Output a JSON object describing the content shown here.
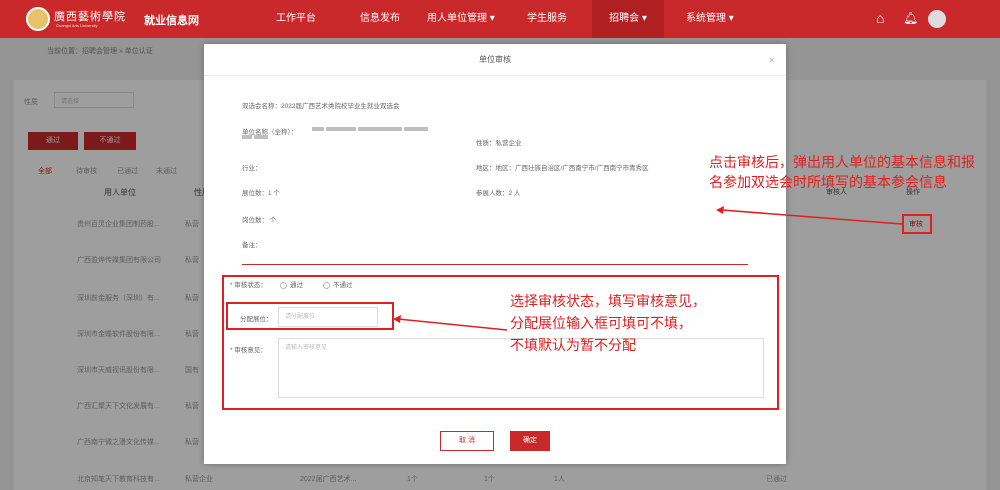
{
  "header": {
    "school": "廣西藝術學院",
    "school_en": "Guangxi Arts University",
    "site": "就业信息网",
    "nav": [
      "工作平台",
      "信息发布",
      "用人单位管理 ▾",
      "学生服务",
      "招聘会 ▾",
      "系统管理 ▾"
    ]
  },
  "breadcrumb": "当前位置：招聘会管理 » 单位认证",
  "background": {
    "filter_label": "性质",
    "filter_placeholder": "请选择",
    "pass": "通过",
    "fail": "不通过",
    "tabs": [
      "全部",
      "待审核",
      "已通过",
      "未通过"
    ],
    "col_company": "用人单位",
    "col_nature": "性质",
    "col_reviewer": "审核人",
    "col_op": "操作",
    "review_link": "审核",
    "rows": [
      "贵州百灵企业集团制药股...",
      "广西盈烨传媒集团有限公司",
      "深圳前金服务（深圳）有...",
      "深圳市金蝶软件股份有限...",
      "深圳市天威视讯股份有限...",
      "广西汇聚天下文化发展有...",
      "广西南宁微之漫文化传媒...",
      "北京知笔天下教育科技有..."
    ],
    "natures": [
      "私营",
      "私营",
      "私营",
      "私营",
      "国有",
      "私营",
      "私营",
      "私营企业"
    ],
    "last_row": {
      "fair": "2022届广西艺术...",
      "c1": "1个",
      "c2": "1个",
      "c3": "1人",
      "status": "已通过"
    }
  },
  "modal": {
    "title": "单位审核",
    "close": "×",
    "fair": "双选会名称：2022届广西艺术类院校毕业生就业双选会",
    "company": "单位名称（全称）：",
    "nature": "性质：私营企业",
    "industry": "行业：",
    "region": "地区：地区：广西壮族自治区/广西南宁市/广西南宁市青秀区",
    "booths": "展位数：1 个",
    "attendees": "参展人数：2 人",
    "positions": "岗位数： 个",
    "remark": "备注：",
    "status_label": "* 审核状态：",
    "status_opts": [
      "通过",
      "不通过"
    ],
    "booth_label": "分配展位：",
    "booth_placeholder": "请分配展位",
    "opinion_label": "* 审核意见：",
    "opinion_placeholder": "请输入审核意见",
    "cancel": "取 消",
    "ok": "确定"
  },
  "annotations": {
    "note1_l1": "点击审核后，弹出用人单位的基本信息和报",
    "note1_l2": "名参加双选会时所填写的基本参会信息",
    "note2_l1": "选择审核状态，填写审核意见，",
    "note2_l2": "分配展位输入框可填可不填，",
    "note2_l3": "不填默认为暂不分配"
  }
}
